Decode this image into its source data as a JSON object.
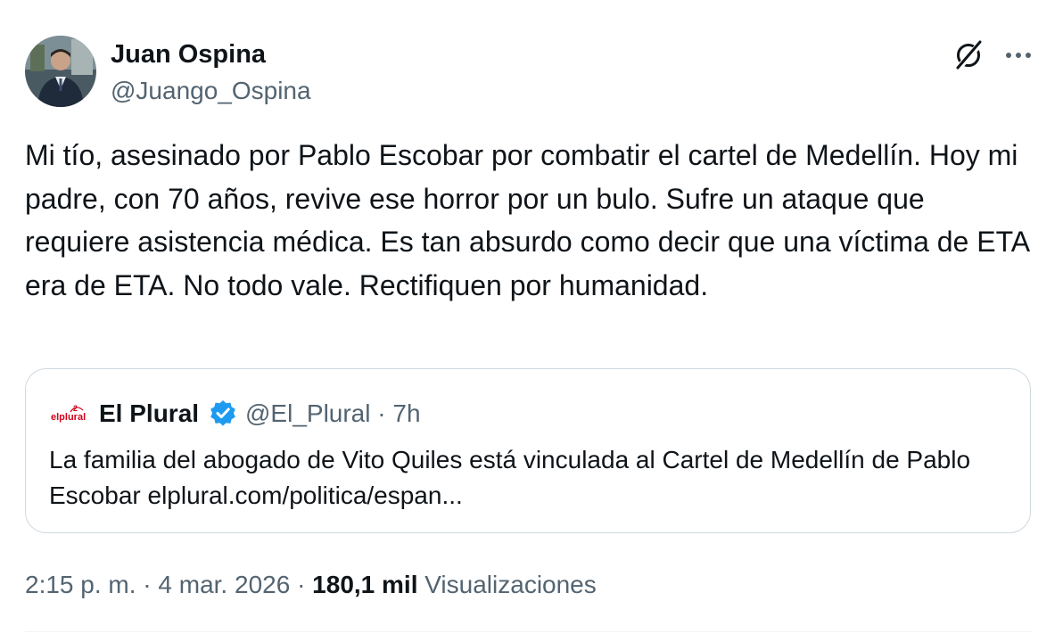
{
  "tweet": {
    "author": {
      "display_name": "Juan Ospina",
      "handle": "@Juango_Ospina"
    },
    "text": "Mi tío, asesinado por Pablo Escobar por combatir el cartel de Medellín. Hoy mi padre, con 70 años, revive ese horror por un bulo. Sufre un ataque que requiere asistencia médica. Es tan absurdo como decir que una víctima de ETA era de ETA. No todo vale. Rectifiquen por humanidad.",
    "icons": {
      "grok": "grok-icon",
      "more": "more-options-icon"
    },
    "quoted": {
      "logo_text": "elplural",
      "display_name": "El Plural",
      "verified": true,
      "handle": "@El_Plural",
      "separator": "·",
      "time": "7h",
      "text": "La familia del abogado de Vito Quiles está vinculada al Cartel de Medellín de Pablo Escobar elplural.com/politica/espan..."
    },
    "meta": {
      "time": "2:15 p. m.",
      "separator": "·",
      "date": "4 mar. 2026",
      "views_count": "180,1 mil",
      "views_label": "Visualizaciones"
    }
  },
  "colors": {
    "text_primary": "#0f1419",
    "text_secondary": "#536471",
    "border": "#cfd9de",
    "verified": "#1d9bf0",
    "logo_red": "#d0021b"
  }
}
